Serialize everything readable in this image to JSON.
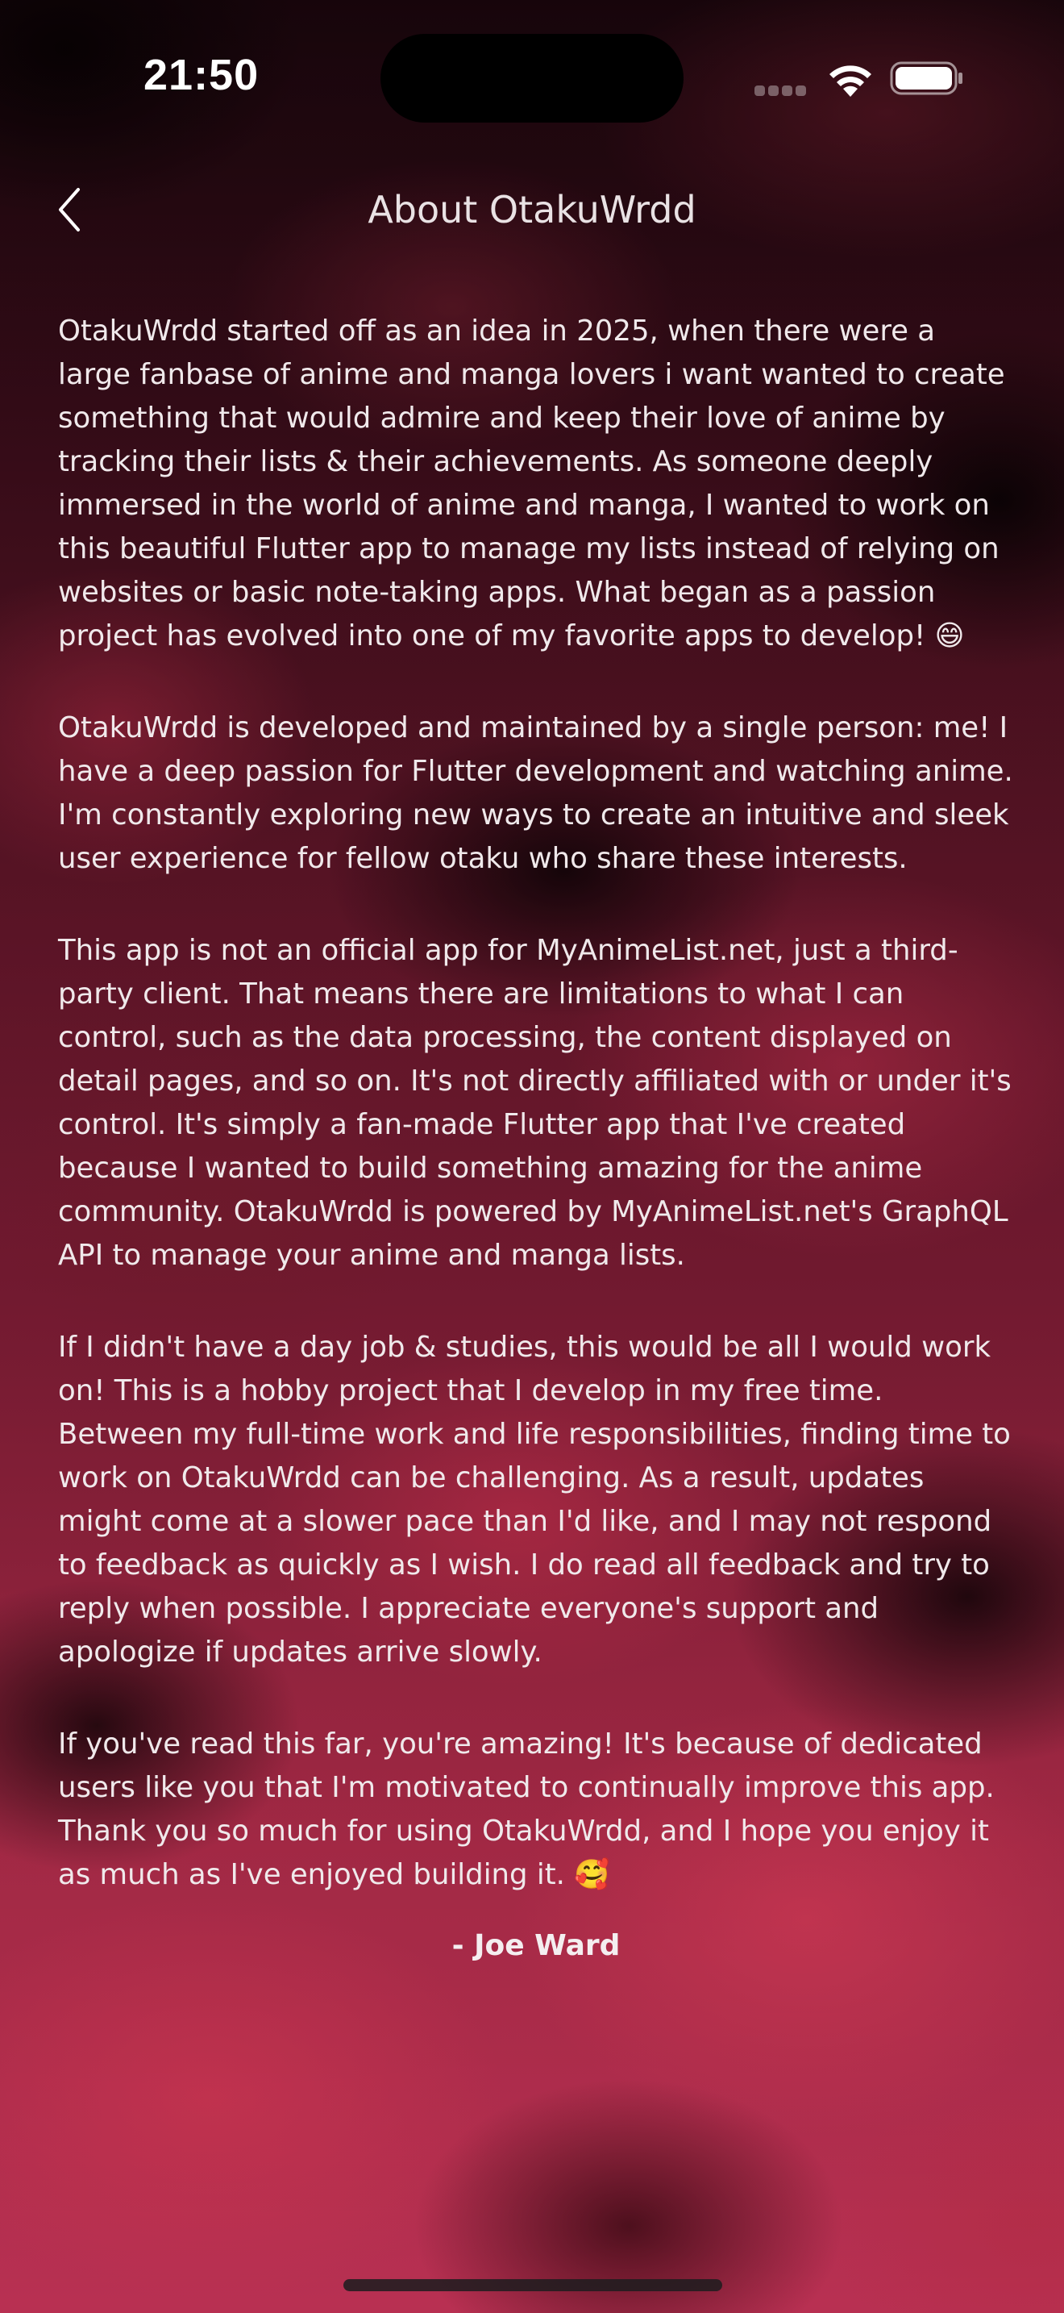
{
  "status_bar": {
    "time": "21:50"
  },
  "nav": {
    "title": "About OtakuWrdd",
    "back_icon": "chevron-left-icon"
  },
  "content": {
    "paragraphs": [
      "OtakuWrdd started off as an idea in 2025, when there were a large fanbase of anime and manga lovers i want wanted to create something that would admire and keep their love of anime by tracking their lists & their achievements. As someone deeply immersed in the world of anime and manga, I wanted to work on this beautiful Flutter app to manage my lists instead of relying on websites or basic note-taking apps. What began as a passion project has evolved into one of my favorite apps to develop! 😄",
      "OtakuWrdd is developed and maintained by a single person: me! I have a deep passion for Flutter development and watching anime. I'm constantly exploring new ways to create an intuitive and sleek user experience for fellow otaku who share these interests.",
      "This app is not an official app for MyAnimeList.net, just a third-party client. That means there are limitations to what I can control, such as the data processing, the content displayed on detail pages, and so on. It's not directly affiliated with or under it's control. It's simply a fan-made Flutter app that I've created because I wanted to build something amazing for the anime community. OtakuWrdd is powered by MyAnimeList.net's GraphQL API to manage your anime and manga lists.",
      "If I didn't have a day job & studies, this would be all I would work on! This is a hobby project that I develop in my free time. Between my full-time work and life responsibilities, finding time to work on OtakuWrdd can be challenging. As a result, updates might come at a slower pace than I'd like, and I may not respond to feedback as quickly as I wish. I do read all feedback and try to reply when possible. I appreciate everyone's support and apologize if updates arrive slowly.",
      "If you've read this far, you're amazing! It's because of dedicated users like you that I'm motivated to continually improve this app. Thank you so much for using OtakuWrdd, and I hope you enjoy it as much as I've enjoyed building it. 🥰"
    ],
    "signature": "- Joe Ward"
  },
  "colors": {
    "background_dark": "#230811",
    "background_accent": "#b83052",
    "text": "#f0e9eb"
  }
}
